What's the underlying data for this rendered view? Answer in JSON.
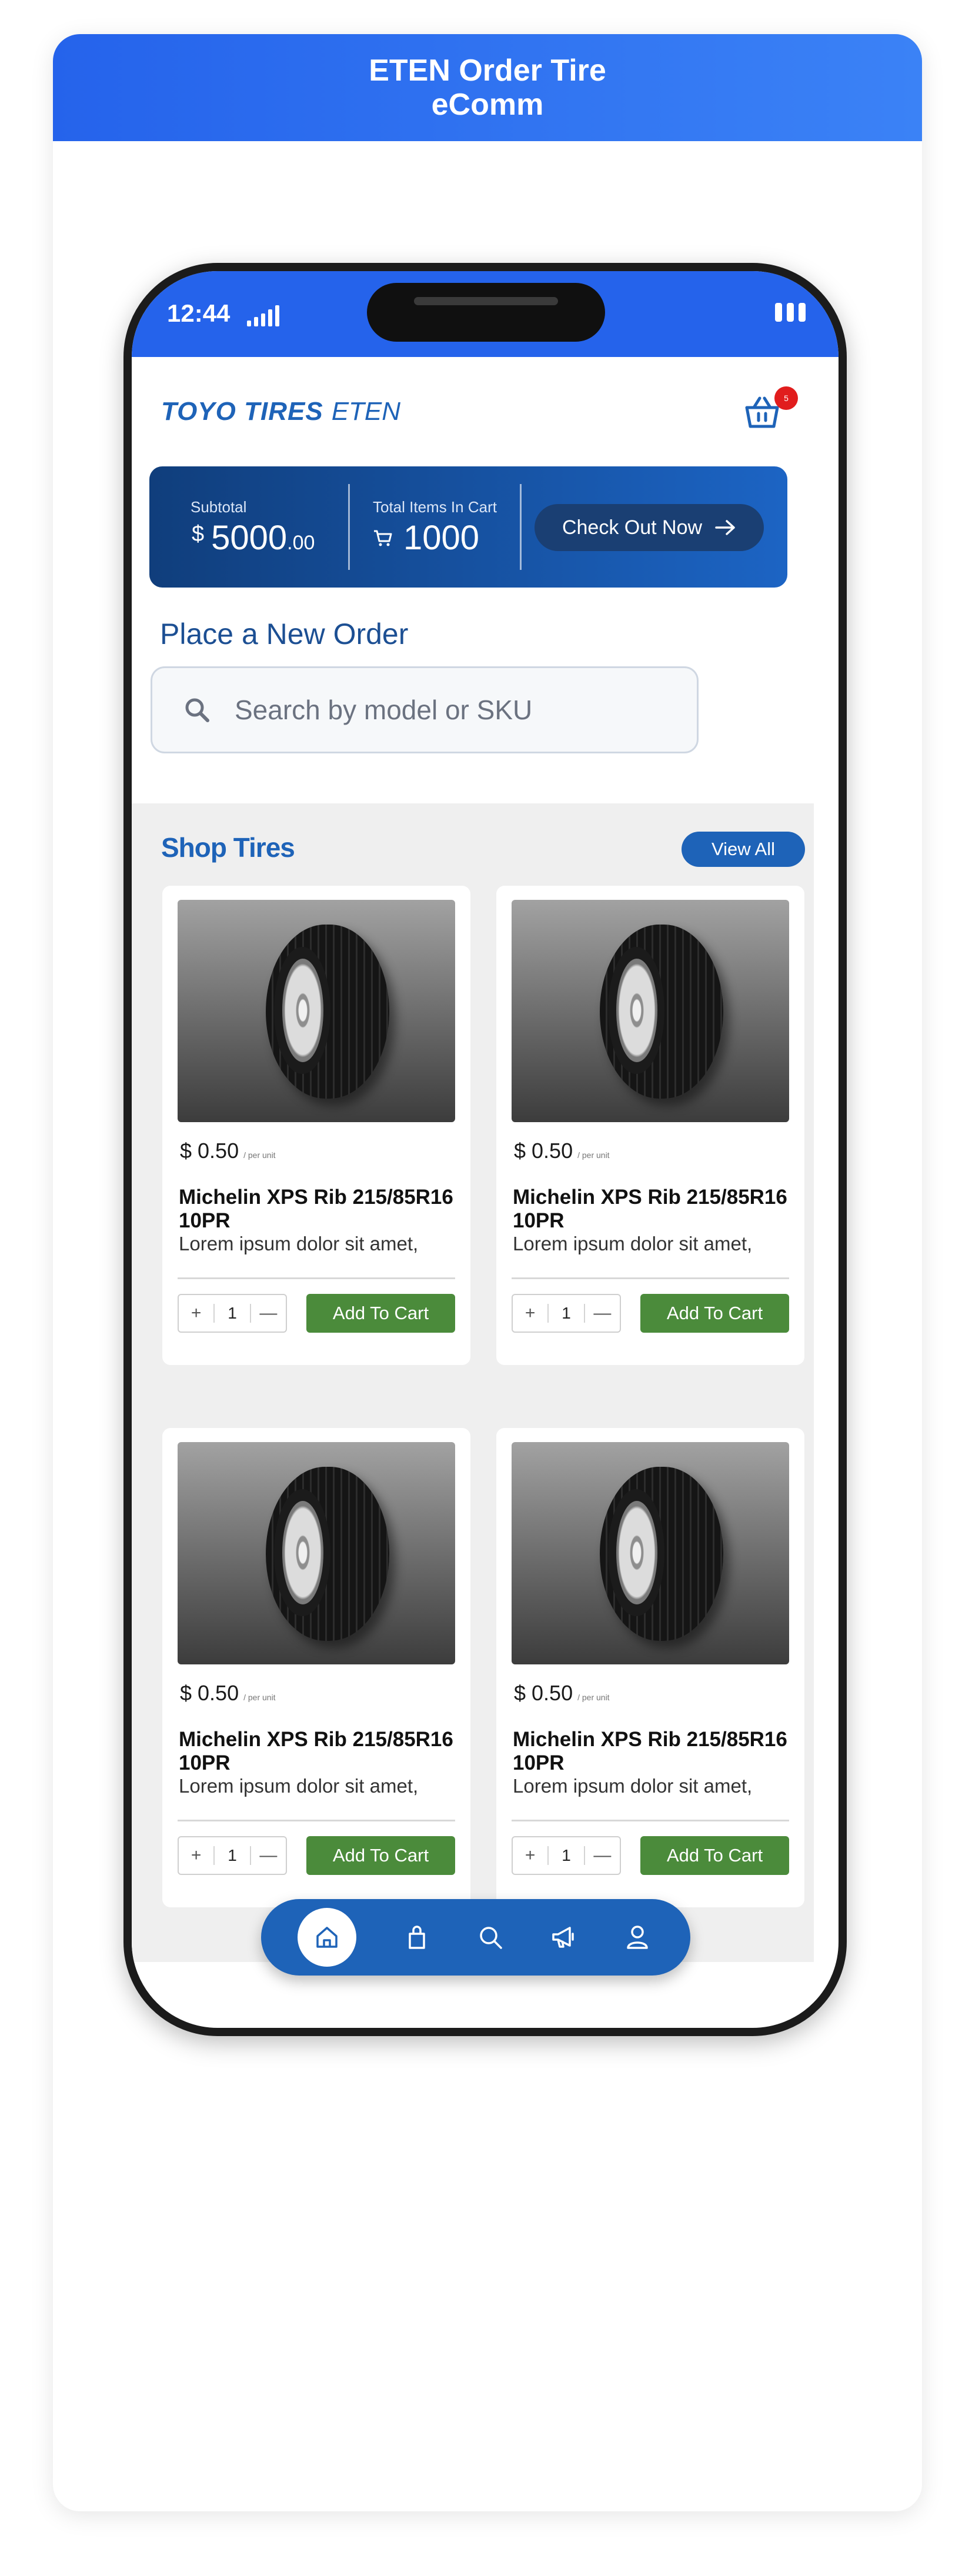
{
  "card": {
    "title_line1": "ETEN Order Tire",
    "title_line2": "eComm"
  },
  "status_bar": {
    "time": "12:44"
  },
  "header": {
    "brand": "TOYO TIRES",
    "sub_brand": "ETEN",
    "cart_badge": "5"
  },
  "summary": {
    "subtotal_label": "Subtotal",
    "currency": "$",
    "subtotal_whole": "5000",
    "subtotal_cents": ".00",
    "items_label": "Total Items In Cart",
    "items_count": "1000",
    "checkout_label": "Check Out Now"
  },
  "order": {
    "title": "Place a New Order",
    "search_placeholder": "Search by model or SKU"
  },
  "shop": {
    "title": "Shop Tires",
    "view_all": "View All",
    "products": [
      {
        "price": "$ 0.50",
        "unit": "/ per unit",
        "name": "Michelin XPS Rib 215/85R16 10PR",
        "desc": "Lorem ipsum dolor sit amet,",
        "qty": "1",
        "add_label": "Add To Cart"
      },
      {
        "price": "$ 0.50",
        "unit": "/ per unit",
        "name": "Michelin XPS Rib 215/85R16 10PR",
        "desc": "Lorem ipsum dolor sit amet,",
        "qty": "1",
        "add_label": "Add To Cart"
      },
      {
        "price": "$ 0.50",
        "unit": "/ per unit",
        "name": "Michelin XPS Rib 215/85R16 10PR",
        "desc": "Lorem ipsum dolor sit amet,",
        "qty": "1",
        "add_label": "Add To Cart"
      },
      {
        "price": "$ 0.50",
        "unit": "/ per unit",
        "name": "Michelin XPS Rib 215/85R16 10PR",
        "desc": "Lorem ipsum dolor sit amet,",
        "qty": "1",
        "add_label": "Add To Cart"
      }
    ],
    "stepper_plus": "+",
    "stepper_minus": "—"
  },
  "tabbar": {
    "icons": [
      "home-icon",
      "shopping-bag-icon",
      "search-icon",
      "megaphone-icon",
      "user-icon"
    ],
    "accent": "#1e63b8"
  },
  "colors": {
    "brand_blue": "#1e63b8",
    "status_blue": "#2563eb",
    "cart_green": "#4b8b3b",
    "badge_red": "#e11d1d"
  }
}
